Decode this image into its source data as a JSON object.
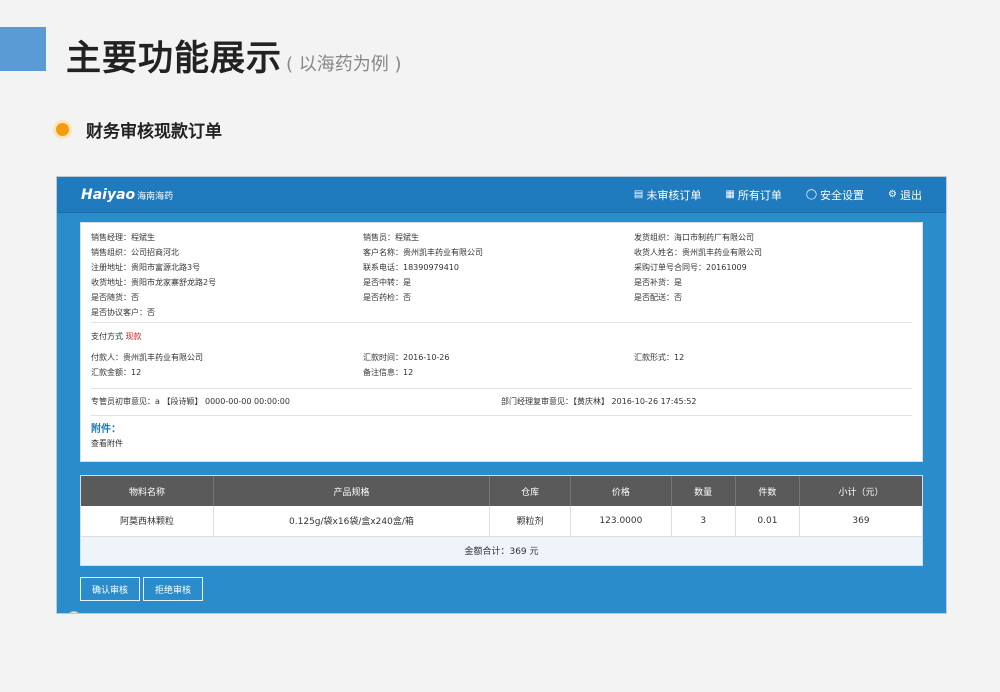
{
  "slide": {
    "title": "主要功能展示",
    "subtitle": "( 以海药为例 )",
    "section": "财务审核现款订单",
    "accent_color": "#5b9bd5",
    "bullet_color": "#f39c12"
  },
  "app": {
    "logo_en": "Haiyao",
    "logo_cn": "海南海药",
    "nav": [
      {
        "icon": "document-icon",
        "label": "未审核订单"
      },
      {
        "icon": "orders-icon",
        "label": "所有订单"
      },
      {
        "icon": "shield-icon",
        "label": "安全设置"
      },
      {
        "icon": "power-icon",
        "label": "退出"
      }
    ],
    "primary_color": "#1f7bbd"
  },
  "order_info": {
    "col1": [
      "销售经理：程斌生",
      "销售组织：公司招商河北",
      "注册地址：贵阳市富源北路3号",
      "收货地址：贵阳市龙家寨舒龙路2号",
      "是否随货：否",
      "是否协议客户：否"
    ],
    "col2": [
      "销售员：程斌生",
      "客户名称：贵州凯丰药业有限公司",
      "联系电话：18390979410",
      "是否中转：是",
      "是否药检：否"
    ],
    "col3": [
      "发货组织：海口市制药厂有限公司",
      "收货人姓名：贵州凯丰药业有限公司",
      "采购订单号合同号：20161009",
      "是否补货：是",
      "是否配送：否"
    ],
    "payment_label": "支付方式",
    "payment_value": "现款",
    "payer": "付款人：贵州凯丰药业有限公司",
    "remit_time": "汇款时间：2016-10-26",
    "remit_form": "汇款形式：12",
    "remit_amount": "汇款金额：12",
    "remark": "备注信息：12",
    "opinion1": "专管员初审意见：a 【段诗颖】 0000-00-00 00:00:00",
    "opinion2": "部门经理复审意见：【黄庆林】 2016-10-26 17:45:52",
    "attachment_title": "附件：",
    "attachment_link": "查看附件"
  },
  "table": {
    "headers": [
      "物料名称",
      "产品规格",
      "仓库",
      "价格",
      "数量",
      "件数",
      "小计（元）"
    ],
    "rows": [
      [
        "阿莫西林颗粒",
        "0.125g/袋x16袋/盒x240盒/箱",
        "颗粒剂",
        "123.0000",
        "3",
        "0.01",
        "369"
      ]
    ],
    "total": "金额合计：369 元"
  },
  "buttons": {
    "approve": "确认审核",
    "reject": "拒绝审核"
  }
}
